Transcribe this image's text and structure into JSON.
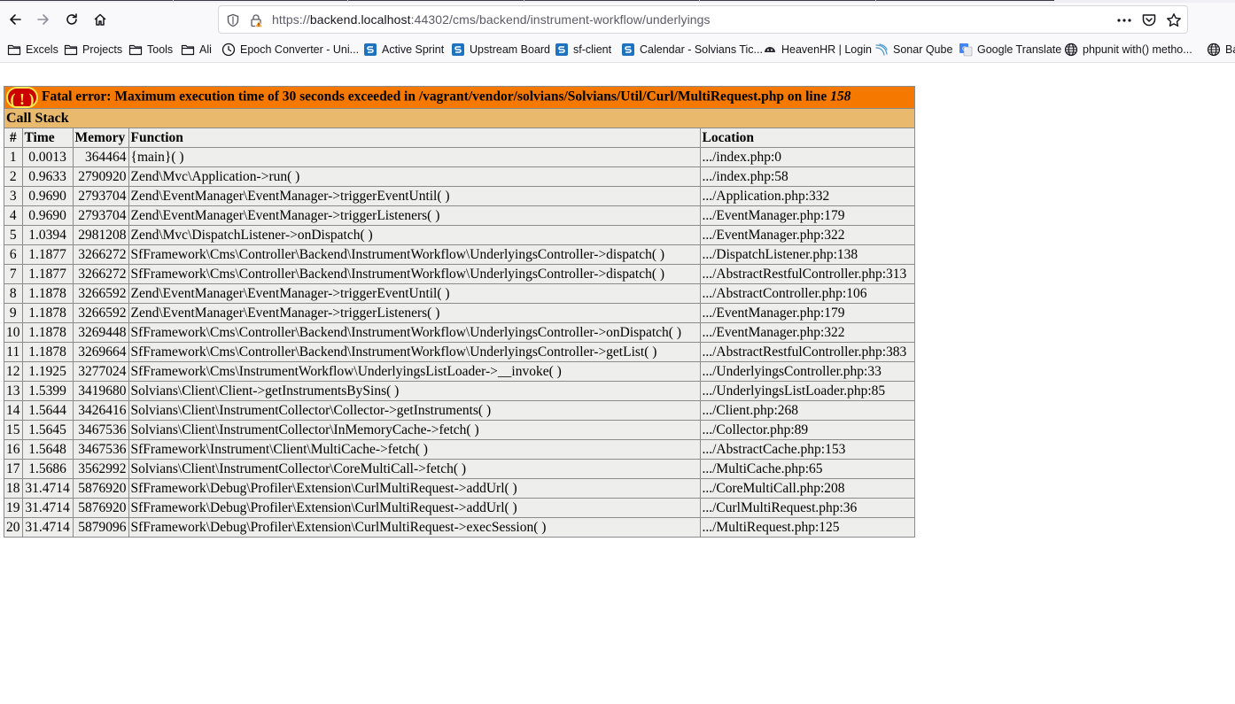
{
  "browser": {
    "url_prefix": "https://",
    "url_host": "backend.localhost",
    "url_rest": ":44302/cms/backend/instrument-workflow/underlyings",
    "icons": {
      "back": "back-arrow-icon",
      "forward": "forward-arrow-icon",
      "reload": "reload-icon",
      "home": "home-icon",
      "tracking": "shield-icon",
      "security": "lock-warning-icon",
      "page_actions": "more-horizontal-icon",
      "pocket": "pocket-icon",
      "bookmark": "star-icon"
    }
  },
  "bookmarks": [
    {
      "label": "Excels",
      "icon": "folder-icon"
    },
    {
      "label": "Projects",
      "icon": "folder-icon"
    },
    {
      "label": "Tools",
      "icon": "folder-icon"
    },
    {
      "label": "Ali",
      "icon": "folder-icon"
    },
    {
      "label": "Epoch Converter - Uni...",
      "icon": "clock-icon"
    },
    {
      "label": "Active Sprint",
      "icon": "solvians-icon"
    },
    {
      "label": "Upstream Board",
      "icon": "solvians-icon"
    },
    {
      "label": "sf-client",
      "icon": "solvians-icon"
    },
    {
      "label": "Calendar - Solvians Tic...",
      "icon": "solvians-icon"
    },
    {
      "label": "HeavenHR | Login",
      "icon": "heavenhr-icon"
    },
    {
      "label": "Sonar Qube",
      "icon": "sonarqube-icon"
    },
    {
      "label": "Google Translate",
      "icon": "translate-icon"
    },
    {
      "label": "phpunit with() metho...",
      "icon": "globe-icon"
    },
    {
      "label": "Ba",
      "icon": "globe-icon"
    }
  ],
  "error": {
    "badge": "( ! )",
    "message": "Fatal error: Maximum execution time of 30 seconds exceeded in /vagrant/vendor/solvians/Solvians/Util/Curl/MultiRequest.php on line ",
    "line": "158",
    "call_stack_label": "Call Stack",
    "colors": {
      "error_bg": "#f57900",
      "callstack_bg": "#e9b96e",
      "cell_bg": "#eeeeec",
      "badge_bg": "#cc0000",
      "badge_fg": "#fce94f"
    }
  },
  "table": {
    "headers": [
      "#",
      "Time",
      "Memory",
      "Function",
      "Location"
    ],
    "rows": [
      [
        "1",
        "0.0013",
        "364464",
        "{main}( )",
        ".../index.php:0"
      ],
      [
        "2",
        "0.9633",
        "2790920",
        "Zend\\Mvc\\Application->run( )",
        ".../index.php:58"
      ],
      [
        "3",
        "0.9690",
        "2793704",
        "Zend\\EventManager\\EventManager->triggerEventUntil( )",
        ".../Application.php:332"
      ],
      [
        "4",
        "0.9690",
        "2793704",
        "Zend\\EventManager\\EventManager->triggerListeners( )",
        ".../EventManager.php:179"
      ],
      [
        "5",
        "1.0394",
        "2981208",
        "Zend\\Mvc\\DispatchListener->onDispatch( )",
        ".../EventManager.php:322"
      ],
      [
        "6",
        "1.1877",
        "3266272",
        "SfFramework\\Cms\\Controller\\Backend\\InstrumentWorkflow\\UnderlyingsController->dispatch( )",
        ".../DispatchListener.php:138"
      ],
      [
        "7",
        "1.1877",
        "3266272",
        "SfFramework\\Cms\\Controller\\Backend\\InstrumentWorkflow\\UnderlyingsController->dispatch( )",
        ".../AbstractRestfulController.php:313"
      ],
      [
        "8",
        "1.1878",
        "3266592",
        "Zend\\EventManager\\EventManager->triggerEventUntil( )",
        ".../AbstractController.php:106"
      ],
      [
        "9",
        "1.1878",
        "3266592",
        "Zend\\EventManager\\EventManager->triggerListeners( )",
        ".../EventManager.php:179"
      ],
      [
        "10",
        "1.1878",
        "3269448",
        "SfFramework\\Cms\\Controller\\Backend\\InstrumentWorkflow\\UnderlyingsController->onDispatch( )",
        ".../EventManager.php:322"
      ],
      [
        "11",
        "1.1878",
        "3269664",
        "SfFramework\\Cms\\Controller\\Backend\\InstrumentWorkflow\\UnderlyingsController->getList( )",
        ".../AbstractRestfulController.php:383"
      ],
      [
        "12",
        "1.1925",
        "3277024",
        "SfFramework\\Cms\\InstrumentWorkflow\\UnderlyingsListLoader->__invoke( )",
        ".../UnderlyingsController.php:33"
      ],
      [
        "13",
        "1.5399",
        "3419680",
        "Solvians\\Client\\Client->getInstrumentsBySins( )",
        ".../UnderlyingsListLoader.php:85"
      ],
      [
        "14",
        "1.5644",
        "3426416",
        "Solvians\\Client\\InstrumentCollector\\Collector->getInstruments( )",
        ".../Client.php:268"
      ],
      [
        "15",
        "1.5645",
        "3467536",
        "Solvians\\Client\\InstrumentCollector\\InMemoryCache->fetch( )",
        ".../Collector.php:89"
      ],
      [
        "16",
        "1.5648",
        "3467536",
        "SfFramework\\Instrument\\Client\\MultiCache->fetch( )",
        ".../AbstractCache.php:153"
      ],
      [
        "17",
        "1.5686",
        "3562992",
        "Solvians\\Client\\InstrumentCollector\\CoreMultiCall->fetch( )",
        ".../MultiCache.php:65"
      ],
      [
        "18",
        "31.4714",
        "5876920",
        "SfFramework\\Debug\\Profiler\\Extension\\CurlMultiRequest->addUrl( )",
        ".../CoreMultiCall.php:208"
      ],
      [
        "19",
        "31.4714",
        "5876920",
        "SfFramework\\Debug\\Profiler\\Extension\\CurlMultiRequest->addUrl( )",
        ".../CurlMultiRequest.php:36"
      ],
      [
        "20",
        "31.4714",
        "5879096",
        "SfFramework\\Debug\\Profiler\\Extension\\CurlMultiRequest->execSession( )",
        ".../MultiRequest.php:125"
      ]
    ]
  }
}
